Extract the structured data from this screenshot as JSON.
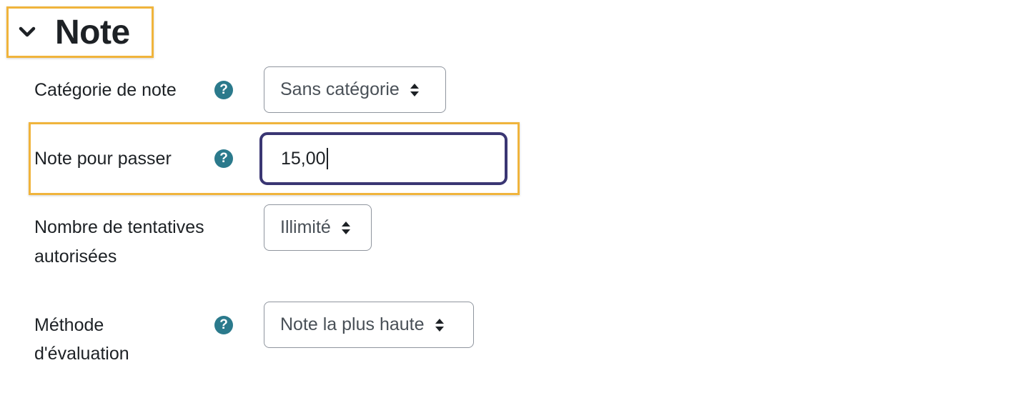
{
  "section": {
    "title": "Note",
    "toggle_icon": "chevron-down-icon"
  },
  "fields": {
    "grade_category": {
      "label": "Catégorie de note",
      "value": "Sans catégorie",
      "help_glyph": "?"
    },
    "grade_to_pass": {
      "label": "Note pour passer",
      "value": "15,00",
      "help_glyph": "?"
    },
    "attempts": {
      "label_line1": "Nombre de tentatives",
      "label_line2": "autorisées",
      "value": "Illimité"
    },
    "grading_method": {
      "label_line1": "Méthode",
      "label_line2": "d'évaluation",
      "value": "Note la plus haute",
      "help_glyph": "?"
    }
  },
  "colors": {
    "highlight": "#f0b43c",
    "help_icon": "#2b7a8c",
    "focus_border": "#3a3673",
    "text": "#1d2125"
  }
}
